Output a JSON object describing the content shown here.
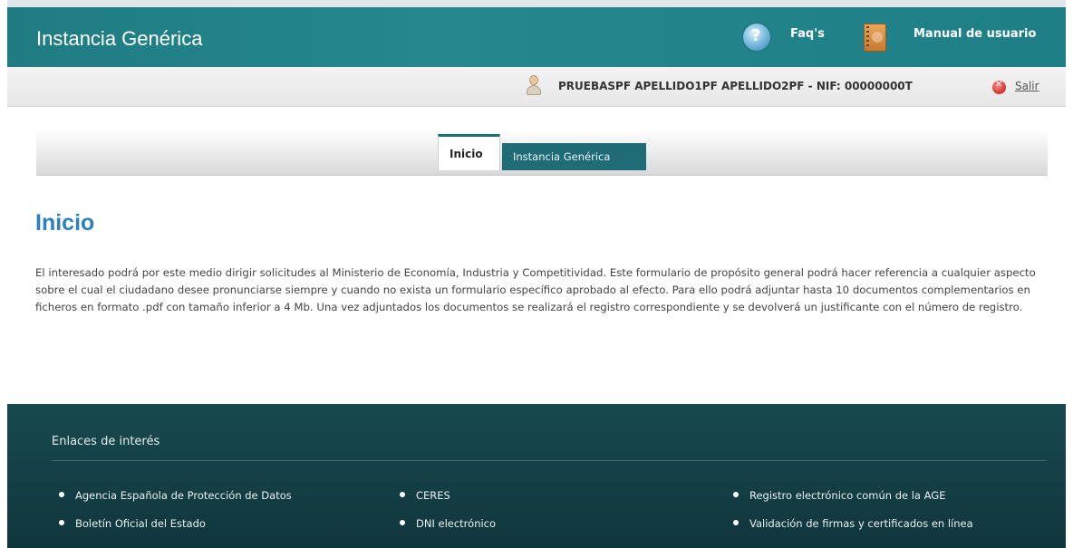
{
  "header": {
    "app_title": "Instancia Genérica",
    "faq_label": "Faq's",
    "manual_label": "Manual de usuario"
  },
  "userbar": {
    "user_name": "PRUEBASPF APELLIDO1PF APELLIDO2PF - NIF: 00000000T",
    "logout_label": "Salir"
  },
  "tabs": [
    {
      "label": "Inicio",
      "active": true
    },
    {
      "label": "Instancia Genérica",
      "active": false
    }
  ],
  "main": {
    "heading": "Inicio",
    "intro": "El interesado podrá por este medio dirigir solicitudes al Ministerio de Economía, Industria y Competitividad. Este formulario de propósito general podrá hacer referencia a cualquier aspecto sobre el cual el ciudadano desee pronunciarse siempre y cuando no exista un formulario específico aprobado al efecto. Para ello podrá adjuntar hasta 10 documentos complementarios en ficheros en formato .pdf con tamaño inferior a 4 Mb. Una vez adjuntados los documentos se realizará el registro correspondiente y se devolverá un justificante con el número de registro."
  },
  "footer": {
    "title": "Enlaces de interés",
    "links": [
      {
        "label": "Agencia Española de Protección de Datos"
      },
      {
        "label": "CERES"
      },
      {
        "label": "Registro electrónico común de la AGE"
      },
      {
        "label": "Boletín Oficial del Estado"
      },
      {
        "label": "DNI electrónico"
      },
      {
        "label": "Validación de firmas y certificados en línea"
      }
    ]
  },
  "colors": {
    "header_teal": "#1f7c82",
    "heading_blue": "#2c7fc1",
    "footer_dark": "#12393f"
  }
}
